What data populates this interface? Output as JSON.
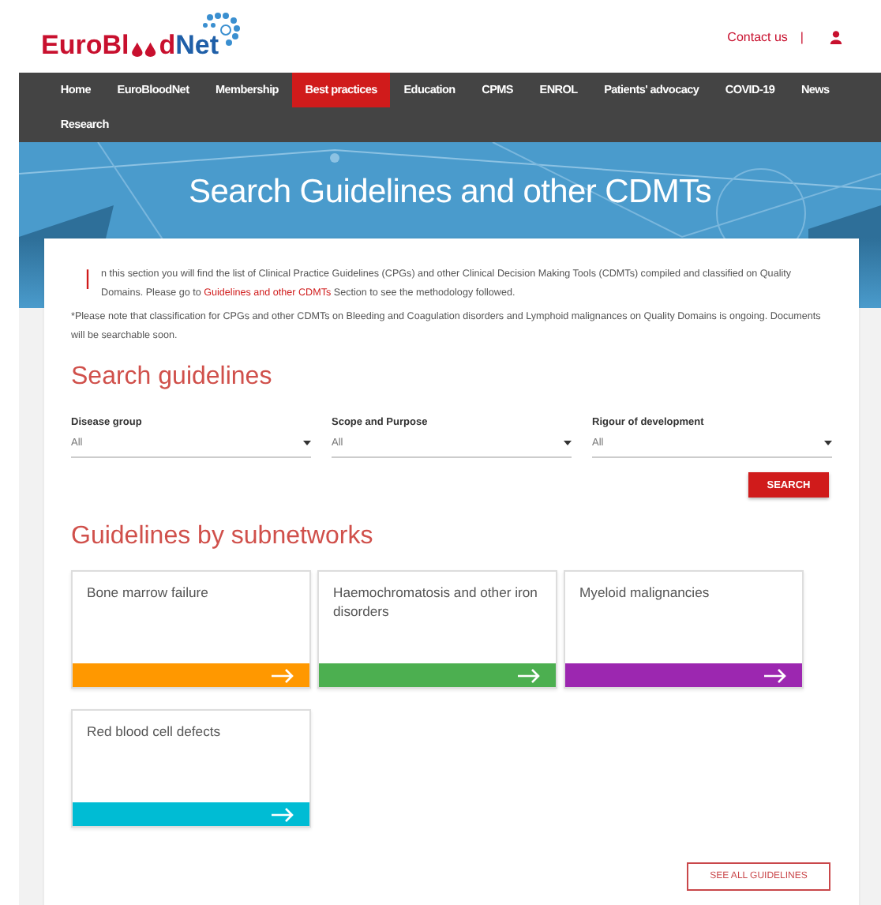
{
  "header": {
    "logo": {
      "lead": "EuroBl",
      "tail": "d",
      "accent": "Net"
    },
    "contact": "Contact us",
    "separator": "|"
  },
  "nav": [
    {
      "label": "Home",
      "selected": false
    },
    {
      "label": "EuroBloodNet",
      "selected": false
    },
    {
      "label": "Membership",
      "selected": false
    },
    {
      "label": "Best practices",
      "selected": true
    },
    {
      "label": "Education",
      "selected": false
    },
    {
      "label": "CPMS",
      "selected": false
    },
    {
      "label": "ENROL",
      "selected": false
    },
    {
      "label": "Patients' advocacy",
      "selected": false
    },
    {
      "label": "COVID-19",
      "selected": false
    },
    {
      "label": "News",
      "selected": false
    },
    {
      "label": "Research",
      "selected": false
    }
  ],
  "banner": {
    "title": "Search Guidelines and other CDMTs"
  },
  "intro": {
    "dropcap": "I",
    "text": "n this section you will find the list of Clinical Practice Guidelines (CPGs) and other Clinical Decision Making Tools (CDMTs) compiled and classified on Quality Domains. Please go to **Guidelines and other CDMTs** Section to see the methodology followed.",
    "note": "*Please note that classification for CPGs and other CDMTs on Bleeding and Coagulation disorders and Lymphoid malignances on Quality Domains is ongoing. Documents will be searchable soon."
  },
  "search": {
    "heading": "Search guidelines",
    "filters": [
      {
        "label": "Disease group",
        "value": "All"
      },
      {
        "label": "Scope and Purpose",
        "value": "All"
      },
      {
        "label": "Rigour of development",
        "value": "All"
      }
    ],
    "button": "SEARCH"
  },
  "subnetworks": {
    "heading": "Guidelines by subnetworks",
    "cards": [
      {
        "title": "Bone marrow failure",
        "color": "#ff9800"
      },
      {
        "title": "Haemochromatosis and other iron disorders",
        "color": "#4caf50"
      },
      {
        "title": "Myeloid malignancies",
        "color": "#9c27b0"
      },
      {
        "title": "Red blood cell defects",
        "color": "#00bcd4"
      }
    ],
    "see_all": "SEE ALL GUIDELINES"
  }
}
